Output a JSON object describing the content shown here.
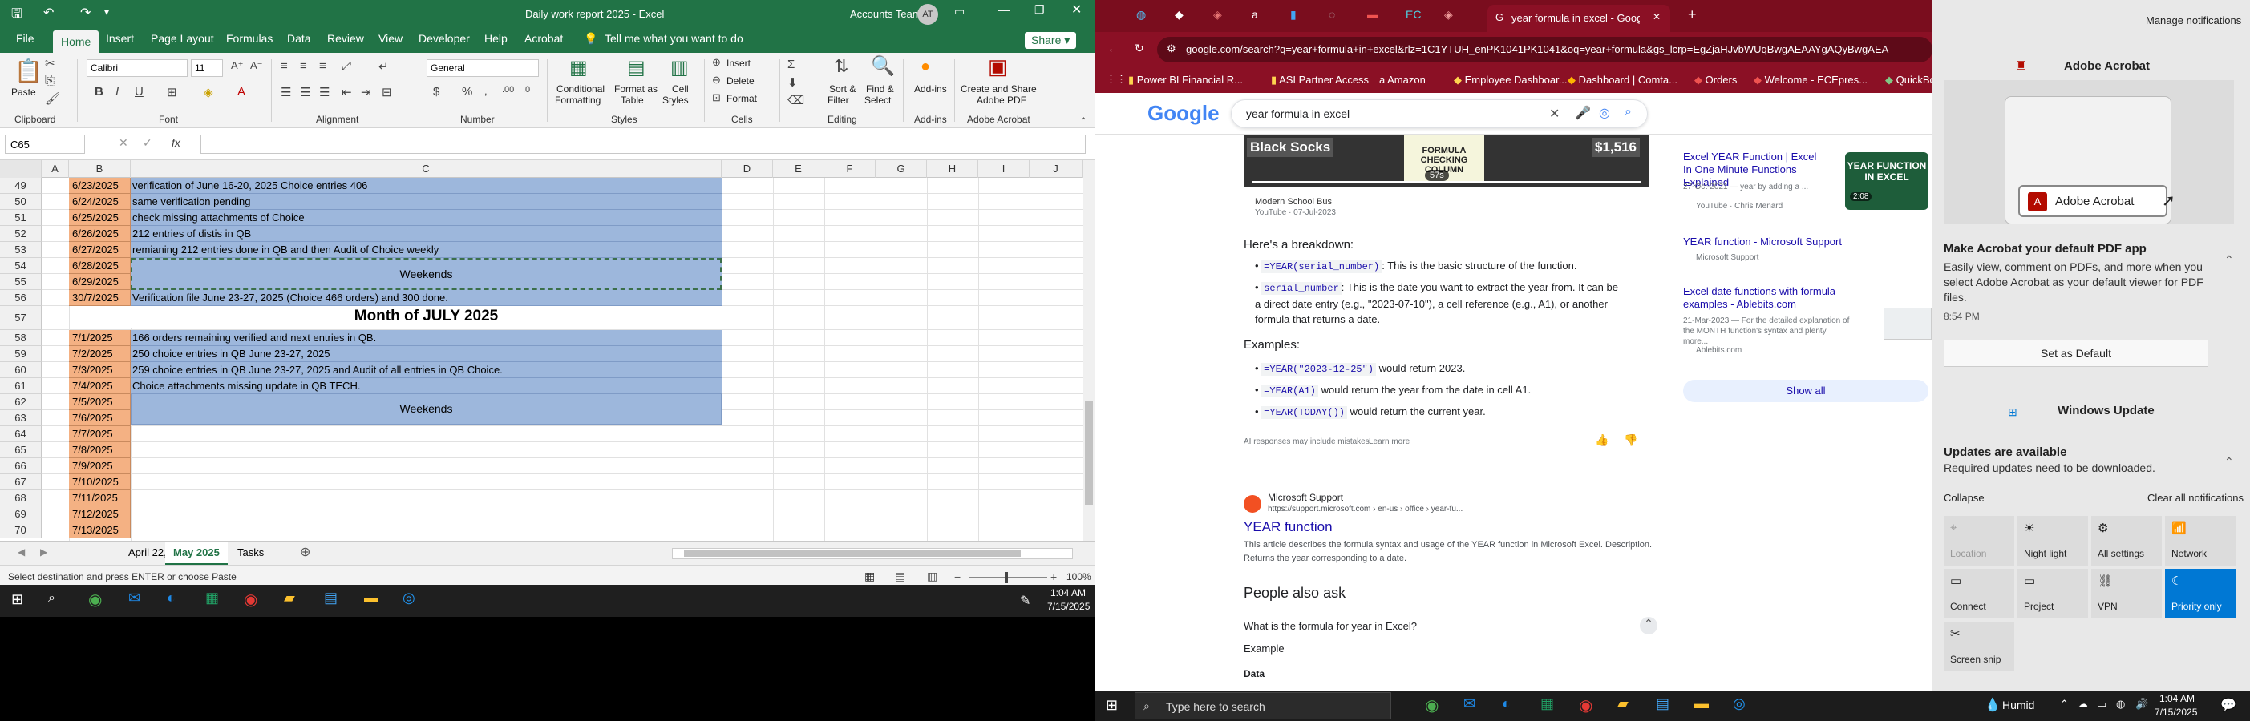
{
  "excel": {
    "title": "Daily work report 2025  -  Excel",
    "account": "Accounts Team",
    "avatar": "AT",
    "share": "Share",
    "tabs": [
      "File",
      "Home",
      "Insert",
      "Page Layout",
      "Formulas",
      "Data",
      "Review",
      "Developer",
      "Help",
      "Acrobat"
    ],
    "tell_me": "Tell me what you want to do",
    "ribbon": {
      "paste": "Paste",
      "clipboard": "Clipboard",
      "font_name": "Calibri",
      "font_size": "11",
      "font": "Font",
      "alignment": "Alignment",
      "number_format": "General",
      "number": "Number",
      "conditional": "Conditional",
      "formatting": "Formatting",
      "format_as": "Format as",
      "table": "Table",
      "cell": "Cell",
      "styles_label": "Styles",
      "styles": "Styles",
      "insert": "Insert",
      "delete": "Delete",
      "format": "Format",
      "cells": "Cells",
      "sort": "Sort &",
      "filter": "Filter",
      "find": "Find &",
      "select": "Select",
      "editing": "Editing",
      "addins": "Add-ins",
      "addins_label": "Add-ins",
      "create_share": "Create and Share",
      "adobe_pdf": "Adobe PDF",
      "adobe_acrobat": "Adobe Acrobat"
    },
    "name_box": "C65",
    "fx": "fx",
    "columns": [
      "A",
      "B",
      "C",
      "D",
      "E",
      "F",
      "G",
      "H",
      "I",
      "J"
    ],
    "rows": [
      {
        "n": "49",
        "b": "6/23/2025",
        "c": "verification of June 16-20, 2025 Choice entries 406"
      },
      {
        "n": "50",
        "b": "6/24/2025",
        "c": "same verification pending"
      },
      {
        "n": "51",
        "b": "6/25/2025",
        "c": "check missing attachments of Choice"
      },
      {
        "n": "52",
        "b": "6/26/2025",
        "c": "212 entries of distis in QB"
      },
      {
        "n": "53",
        "b": "6/27/2025",
        "c": "remianing 212 entries done in QB and then Audit of Choice weekly"
      },
      {
        "n": "54",
        "b": "6/28/2025",
        "c": ""
      },
      {
        "n": "55",
        "b": "6/29/2025",
        "c": ""
      },
      {
        "n": "56",
        "b": "30/7/2025",
        "c": "Verification file June 23-27, 2025 (Choice 466 orders) and 300 done."
      },
      {
        "n": "57",
        "b": "",
        "c": ""
      },
      {
        "n": "58",
        "b": "7/1/2025",
        "c": "166 orders remaining verified and next entries in QB."
      },
      {
        "n": "59",
        "b": "7/2/2025",
        "c": "250 choice entries in QB June 23-27, 2025"
      },
      {
        "n": "60",
        "b": "7/3/2025",
        "c": "259 choice entries in QB June 23-27, 2025 and Audit of all entries in QB Choice."
      },
      {
        "n": "61",
        "b": "7/4/2025",
        "c": "Choice attachments missing update in QB TECH."
      },
      {
        "n": "62",
        "b": "7/5/2025",
        "c": ""
      },
      {
        "n": "63",
        "b": "7/6/2025",
        "c": ""
      },
      {
        "n": "64",
        "b": "7/7/2025",
        "c": ""
      },
      {
        "n": "65",
        "b": "7/8/2025",
        "c": ""
      },
      {
        "n": "66",
        "b": "7/9/2025",
        "c": ""
      },
      {
        "n": "67",
        "b": "7/10/2025",
        "c": ""
      },
      {
        "n": "68",
        "b": "7/11/2025",
        "c": ""
      },
      {
        "n": "69",
        "b": "7/12/2025",
        "c": ""
      },
      {
        "n": "70",
        "b": "7/13/2025",
        "c": ""
      }
    ],
    "weekends_1": "Weekends",
    "month_title": "Month of JULY 2025",
    "weekends_2": "Weekends",
    "sheet_tabs": [
      "April 22,2025",
      "May 2025",
      "Tasks"
    ],
    "active_sheet": "May 2025",
    "status_text": "Select destination and press ENTER or choose Paste",
    "zoom": "100%"
  },
  "chrome": {
    "tabs_title": "year formula in excel - Google",
    "url": "google.com/search?q=year+formula+in+excel&rlz=1C1YTUH_enPK1041PK1041&oq=year+formula&gs_lcrp=EgZjaHJvbWUqBwgAEAAYgAQyBwgAEA",
    "bookmarks": [
      "Power BI Financial R...",
      "ASI Partner Access",
      "Amazon",
      "Employee Dashboar...",
      "Dashboard | Comta...",
      "Orders",
      "Welcome - ECEpres...",
      "QuickBo"
    ],
    "search_query": "year formula in excel",
    "google": "Google",
    "video_text": "FORMULA CHECKING COLUMN",
    "video_cell1": "Black Socks",
    "video_cell2": "$1,516",
    "video_time": "57s",
    "video_channel": "Modern School Bus",
    "video_source": "YouTube · 07-Jul-2023",
    "breakdown_heading": "Here's a breakdown:",
    "bullets": [
      {
        "code": "=YEAR(serial_number)",
        "text": ": This is the basic structure of the function."
      },
      {
        "code": "serial_number",
        "text": ": This is the date you want to extract the year from. It can be a direct date entry (e.g., \"2023-07-10\"), a cell reference (e.g., A1), or another formula that returns a date."
      }
    ],
    "examples_heading": "Examples:",
    "examples": [
      {
        "code": "=YEAR(\"2023-12-25\")",
        "text": "would return 2023."
      },
      {
        "code": "=YEAR(A1)",
        "text": "would return the year from the date in cell A1."
      },
      {
        "code": "=YEAR(TODAY())",
        "text": "would return the current year."
      }
    ],
    "ai_note": "AI responses may include mistakes.",
    "learn_more": "Learn more",
    "side_results": [
      {
        "title": "Excel YEAR Function | Excel In One Minute Functions Explained",
        "meta": "27-Oct-2021 — year by adding a ...",
        "source": "YouTube · Chris Menard"
      },
      {
        "title": "YEAR function - Microsoft Support",
        "meta": "",
        "source": "Microsoft Support"
      },
      {
        "title": "Excel date functions with formula examples - Ablebits.com",
        "meta": "21-Mar-2023 — For the detailed explanation of the MONTH function's syntax and plenty more...",
        "source": "Ablebits.com"
      }
    ],
    "thumb_text": "YEAR FUNCTION IN EXCEL",
    "thumb_time": "2:08",
    "show_all": "Show all",
    "result_site": "Microsoft Support",
    "result_url": "https://support.microsoft.com › en-us › office › year-fu...",
    "result_title": "YEAR function",
    "result_desc": "This article describes the formula syntax and usage of the YEAR function in Microsoft Excel. Description. Returns the year corresponding to a date.",
    "paa_heading": "People also ask",
    "paa_q1": "What is the formula for year in Excel?",
    "paa_example": "Example",
    "paa_data": "Data"
  },
  "notifications": {
    "manage": "Manage notifications",
    "acrobat_app": "Adobe Acrobat",
    "acrobat_card_label": "Adobe Acrobat",
    "acrobat_title": "Make Acrobat your default PDF app",
    "acrobat_body": "Easily view, comment on PDFs, and more when you select Adobe Acrobat as your default viewer for PDF files.",
    "acrobat_time": "8:54 PM",
    "set_default": "Set as Default",
    "wu_app": "Windows Update",
    "wu_title": "Updates are available",
    "wu_body": "Required updates need to be downloaded.",
    "collapse": "Collapse",
    "clear_all": "Clear all notifications",
    "tiles": [
      {
        "label": "Location",
        "icon": "location-icon",
        "active": false,
        "dim": true
      },
      {
        "label": "Night light",
        "icon": "night-light-icon",
        "active": false,
        "dim": false
      },
      {
        "label": "All settings",
        "icon": "settings-icon",
        "active": false,
        "dim": false
      },
      {
        "label": "Network",
        "icon": "network-icon",
        "active": false,
        "dim": false
      },
      {
        "label": "Connect",
        "icon": "connect-icon",
        "active": false,
        "dim": false
      },
      {
        "label": "Project",
        "icon": "project-icon",
        "active": false,
        "dim": false
      },
      {
        "label": "VPN",
        "icon": "vpn-icon",
        "active": false,
        "dim": false
      },
      {
        "label": "Priority only",
        "icon": "priority-icon",
        "active": true,
        "dim": false
      },
      {
        "label": "Screen snip",
        "icon": "screen-snip-icon",
        "active": false,
        "dim": false
      }
    ]
  },
  "taskbar_left": {
    "time": "1:04 AM",
    "date": "7/15/2025"
  },
  "taskbar_right": {
    "search_placeholder": "Type here to search",
    "weather": "Humid",
    "time": "1:04 AM",
    "date": "7/15/2025"
  },
  "colors": {
    "excel_green": "#217346",
    "chrome_red": "#8b1025",
    "date_fill": "#f4b183",
    "text_fill": "#9db7dc",
    "accent_blue": "#0078d4"
  }
}
